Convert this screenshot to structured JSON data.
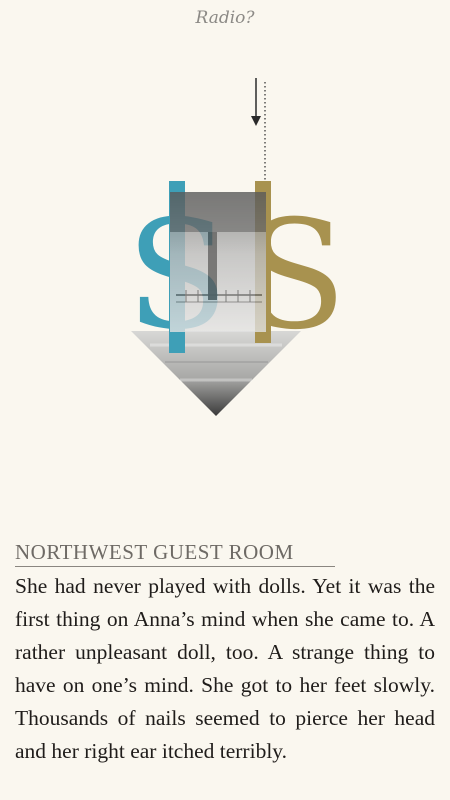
{
  "header": {
    "title": "Radio?"
  },
  "illustration": {
    "name": "dollar-arrow-illustration",
    "left_dollar_color": "#3e9fb7",
    "right_dollar_color": "#a8924f",
    "arrow_color": "#2a2a2a"
  },
  "location": {
    "label": "NORTHWEST GUEST ROOM"
  },
  "story": {
    "text": "She had never played with dolls. Yet it was the first thing on Anna’s mind when she came to. A rather unpleasant doll, too. A strange thing to have on one’s mind. She got to her feet slowly. Thousands of nails seemed to pierce her head and her right ear itched terribly."
  }
}
